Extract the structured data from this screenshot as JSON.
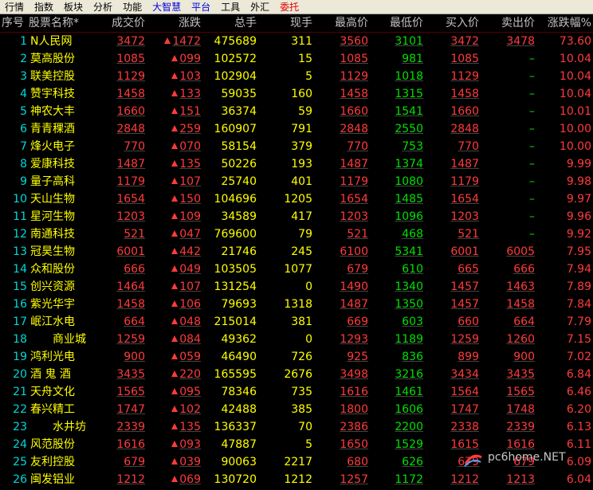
{
  "menu": [
    {
      "label": "行情",
      "color": "black"
    },
    {
      "label": "指数",
      "color": "black"
    },
    {
      "label": "板块",
      "color": "black"
    },
    {
      "label": "分析",
      "color": "black"
    },
    {
      "label": "功能",
      "color": "black"
    },
    {
      "label": "大智慧",
      "color": "blue"
    },
    {
      "label": "平台",
      "color": "blue"
    },
    {
      "label": "工具",
      "color": "black"
    },
    {
      "label": "外汇",
      "color": "black"
    },
    {
      "label": "委托",
      "color": "red"
    }
  ],
  "columns": [
    "序号",
    "股票名称*",
    "成交价",
    "涨跌",
    "总手",
    "现手",
    "最高价",
    "最低价",
    "买入价",
    "卖出价",
    "涨跌幅%"
  ],
  "rows": [
    {
      "no": "1",
      "name": "N人民网",
      "price": "3472",
      "change": "1472",
      "volume": "475689",
      "cur": "311",
      "high": "3560",
      "low": "3101",
      "bid": "3472",
      "ask": "3478",
      "pct": "73.60"
    },
    {
      "no": "2",
      "name": "莫高股份",
      "price": "1085",
      "change": "099",
      "volume": "102572",
      "cur": "15",
      "high": "1085",
      "low": "981",
      "bid": "1085",
      "ask": "–",
      "pct": "10.04"
    },
    {
      "no": "3",
      "name": "联美控股",
      "price": "1129",
      "change": "103",
      "volume": "102904",
      "cur": "5",
      "high": "1129",
      "low": "1018",
      "bid": "1129",
      "ask": "–",
      "pct": "10.04"
    },
    {
      "no": "4",
      "name": "赞宇科技",
      "price": "1458",
      "change": "133",
      "volume": "59035",
      "cur": "160",
      "high": "1458",
      "low": "1315",
      "bid": "1458",
      "ask": "–",
      "pct": "10.04"
    },
    {
      "no": "5",
      "name": "神农大丰",
      "price": "1660",
      "change": "151",
      "volume": "36374",
      "cur": "59",
      "high": "1660",
      "low": "1541",
      "bid": "1660",
      "ask": "–",
      "pct": "10.01"
    },
    {
      "no": "6",
      "name": "青青稞酒",
      "price": "2848",
      "change": "259",
      "volume": "160907",
      "cur": "791",
      "high": "2848",
      "low": "2550",
      "bid": "2848",
      "ask": "–",
      "pct": "10.00"
    },
    {
      "no": "7",
      "name": "烽火电子",
      "price": "770",
      "change": "070",
      "volume": "58154",
      "cur": "379",
      "high": "770",
      "low": "753",
      "bid": "770",
      "ask": "–",
      "pct": "10.00"
    },
    {
      "no": "8",
      "name": "爱康科技",
      "price": "1487",
      "change": "135",
      "volume": "50226",
      "cur": "193",
      "high": "1487",
      "low": "1374",
      "bid": "1487",
      "ask": "–",
      "pct": "9.99"
    },
    {
      "no": "9",
      "name": "量子高科",
      "price": "1179",
      "change": "107",
      "volume": "25740",
      "cur": "401",
      "high": "1179",
      "low": "1080",
      "bid": "1179",
      "ask": "–",
      "pct": "9.98"
    },
    {
      "no": "10",
      "name": "天山生物",
      "price": "1654",
      "change": "150",
      "volume": "104696",
      "cur": "1205",
      "high": "1654",
      "low": "1485",
      "bid": "1654",
      "ask": "–",
      "pct": "9.97"
    },
    {
      "no": "11",
      "name": "星河生物",
      "price": "1203",
      "change": "109",
      "volume": "34589",
      "cur": "417",
      "high": "1203",
      "low": "1096",
      "bid": "1203",
      "ask": "–",
      "pct": "9.96"
    },
    {
      "no": "12",
      "name": "南通科技",
      "price": "521",
      "change": "047",
      "volume": "769600",
      "cur": "79",
      "high": "521",
      "low": "468",
      "bid": "521",
      "ask": "–",
      "pct": "9.92"
    },
    {
      "no": "13",
      "name": "冠昊生物",
      "price": "6001",
      "change": "442",
      "volume": "21746",
      "cur": "245",
      "high": "6100",
      "low": "5341",
      "bid": "6001",
      "ask": "6005",
      "pct": "7.95"
    },
    {
      "no": "14",
      "name": "众和股份",
      "price": "666",
      "change": "049",
      "volume": "103505",
      "cur": "1077",
      "high": "679",
      "low": "610",
      "bid": "665",
      "ask": "666",
      "pct": "7.94"
    },
    {
      "no": "15",
      "name": "创兴资源",
      "price": "1464",
      "change": "107",
      "volume": "131254",
      "cur": "0",
      "high": "1490",
      "low": "1340",
      "bid": "1457",
      "ask": "1463",
      "pct": "7.89"
    },
    {
      "no": "16",
      "name": "紫光华宇",
      "price": "1458",
      "change": "106",
      "volume": "79693",
      "cur": "1318",
      "high": "1487",
      "low": "1350",
      "bid": "1457",
      "ask": "1458",
      "pct": "7.84"
    },
    {
      "no": "17",
      "name": "岷江水电",
      "price": "664",
      "change": "048",
      "volume": "215014",
      "cur": "381",
      "high": "669",
      "low": "603",
      "bid": "660",
      "ask": "664",
      "pct": "7.79"
    },
    {
      "no": "18",
      "name": "商业城",
      "price": "1259",
      "change": "084",
      "volume": "49362",
      "cur": "0",
      "high": "1293",
      "low": "1189",
      "bid": "1259",
      "ask": "1260",
      "pct": "7.15"
    },
    {
      "no": "19",
      "name": "鸿利光电",
      "price": "900",
      "change": "059",
      "volume": "46490",
      "cur": "726",
      "high": "925",
      "low": "836",
      "bid": "899",
      "ask": "900",
      "pct": "7.02"
    },
    {
      "no": "20",
      "name": "酒 鬼 酒",
      "price": "3435",
      "change": "220",
      "volume": "165595",
      "cur": "2676",
      "high": "3498",
      "low": "3216",
      "bid": "3434",
      "ask": "3435",
      "pct": "6.84"
    },
    {
      "no": "21",
      "name": "天舟文化",
      "price": "1565",
      "change": "095",
      "volume": "78346",
      "cur": "735",
      "high": "1616",
      "low": "1461",
      "bid": "1564",
      "ask": "1565",
      "pct": "6.46"
    },
    {
      "no": "22",
      "name": "春兴精工",
      "price": "1747",
      "change": "102",
      "volume": "42488",
      "cur": "385",
      "high": "1800",
      "low": "1606",
      "bid": "1747",
      "ask": "1748",
      "pct": "6.20"
    },
    {
      "no": "23",
      "name": "水井坊",
      "price": "2339",
      "change": "135",
      "volume": "136337",
      "cur": "70",
      "high": "2386",
      "low": "2200",
      "bid": "2338",
      "ask": "2339",
      "pct": "6.13"
    },
    {
      "no": "24",
      "name": "风范股份",
      "price": "1616",
      "change": "093",
      "volume": "47887",
      "cur": "5",
      "high": "1650",
      "low": "1529",
      "bid": "1615",
      "ask": "1616",
      "pct": "6.11"
    },
    {
      "no": "25",
      "name": "友利控股",
      "price": "679",
      "change": "039",
      "volume": "90063",
      "cur": "2217",
      "high": "680",
      "low": "626",
      "bid": "679",
      "ask": "679",
      "pct": "6.09"
    },
    {
      "no": "26",
      "name": "闽发铝业",
      "price": "1212",
      "change": "069",
      "volume": "130720",
      "cur": "1212",
      "high": "1257",
      "low": "1172",
      "bid": "1212",
      "ask": "1213",
      "pct": "6.04"
    }
  ],
  "colors": {
    "up": "#FF3B3B",
    "down": "#00E000",
    "name": "#FFFF00",
    "number": "#E8E8E8",
    "index": "#00D8D8"
  },
  "watermark": "pc6home.NET"
}
